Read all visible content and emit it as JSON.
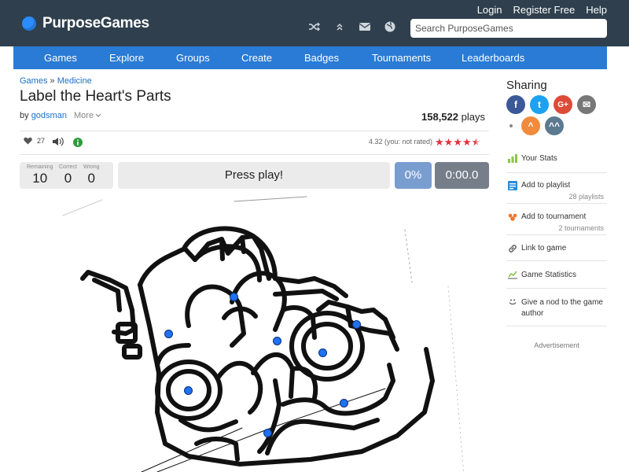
{
  "header": {
    "logo_text": "PurposeGames",
    "links": [
      "Login",
      "Register Free",
      "Help"
    ],
    "search_placeholder": "Search PurposeGames",
    "icons": [
      "shuffle-icon",
      "chevron-up-icon",
      "mail-icon",
      "globe-icon"
    ]
  },
  "nav": {
    "items": [
      "Games",
      "Explore",
      "Groups",
      "Create",
      "Badges",
      "Tournaments",
      "Leaderboards"
    ]
  },
  "game": {
    "breadcrumb": {
      "root": "Games",
      "separator": "»",
      "category": "Medicine"
    },
    "title": "Label the Heart's Parts",
    "by_label": "by",
    "author": "godsman",
    "more_label": "More",
    "plays_count": "158,522",
    "plays_label": "plays",
    "likes": "27",
    "rating_text": "4.32 (you: not rated)",
    "rating_value": 4.32,
    "rating_max": 5
  },
  "scoreboard": {
    "remaining_label": "Remaining",
    "remaining": "10",
    "correct_label": "Correct",
    "correct": "0",
    "wrong_label": "Wrong",
    "wrong": "0",
    "status": "Press play!",
    "percent": "0%",
    "timer": "0:00.0"
  },
  "sidebar": {
    "sharing_title": "Sharing",
    "share_buttons": [
      {
        "name": "facebook",
        "label": "f",
        "color": "#3b5998"
      },
      {
        "name": "twitter",
        "label": "t",
        "color": "#1da1f2"
      },
      {
        "name": "google-plus",
        "label": "G+",
        "color": "#dd4b39"
      },
      {
        "name": "email",
        "label": "✉",
        "color": "#777777"
      },
      {
        "name": "orange-up",
        "label": "^",
        "color": "#f08a3c"
      },
      {
        "name": "double-up",
        "label": "^^",
        "color": "#5b7a8f"
      }
    ],
    "your_stats": "Your Stats",
    "add_playlist": "Add to playlist",
    "playlists_count": "28 playlists",
    "add_tournament": "Add to tournament",
    "tournaments_count": "2 tournaments",
    "link_to_game": "Link to game",
    "game_statistics": "Game Statistics",
    "nod": "Give a nod to the game author",
    "advertisement": "Advertisement"
  },
  "colors": {
    "topbar": "#2f3f4d",
    "nav": "#2a7bd5",
    "accent_link": "#1e6fc8",
    "star": "#e4313f",
    "dot": "#1f72f0"
  }
}
